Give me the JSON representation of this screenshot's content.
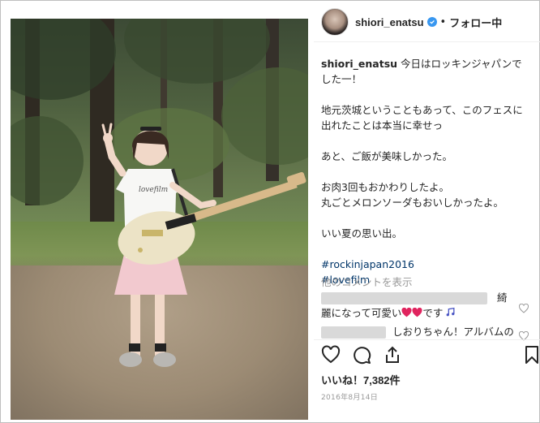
{
  "colors": {
    "text": "#262626",
    "link": "#003569",
    "muted": "#999999",
    "verified": "#3897f0",
    "heart": "#e0245e"
  },
  "header": {
    "username": "shiori_enatsu",
    "separator": "•",
    "follow_label": "フォロー中"
  },
  "caption": {
    "username": "shiori_enatsu",
    "paragraphs": [
      "今日はロッキンジャパンでした一！",
      "地元茨城ということもあって、このフェスに出れたことは本当に幸せっ",
      "あと、ご飯が美味しかった。",
      "お肉3回もおかわりしたよ。\n丸ごとメロンソーダもおいしかったよ。",
      "いい夏の思い出。"
    ],
    "hashtags": [
      "#rockinjapan2016",
      "#lovefilm"
    ]
  },
  "more_comments": "他のコメントを表示",
  "comments": [
    {
      "line1_suffix": "綺",
      "line2": "麗になって可愛い",
      "line2_end": "です"
    },
    {
      "text": "しおりちゃん！アルバムの"
    }
  ],
  "likes": "いいね！7,382件",
  "date": "2016年8月14日",
  "icons": [
    "verified-badge",
    "heart-icon",
    "comment-icon",
    "share-icon",
    "bookmark-icon"
  ],
  "photo": {
    "shirt_text": "lovefilm"
  }
}
